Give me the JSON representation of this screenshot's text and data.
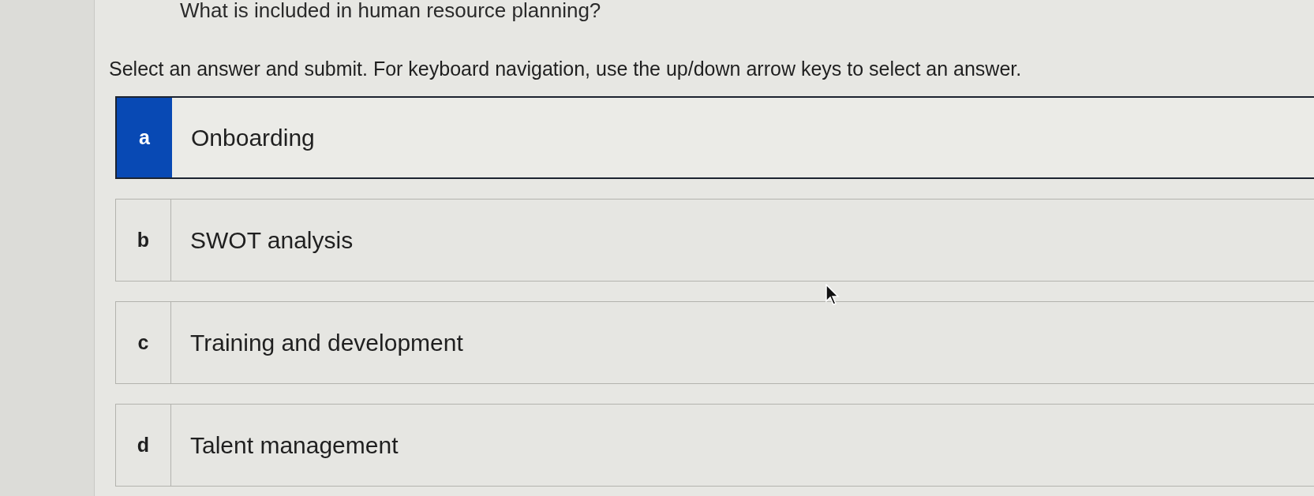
{
  "question": "What is included in human resource planning?",
  "instructions": "Select an answer and submit. For keyboard navigation, use the up/down arrow keys to select an answer.",
  "options": [
    {
      "letter": "a",
      "label": "Onboarding",
      "selected": true
    },
    {
      "letter": "b",
      "label": "SWOT analysis",
      "selected": false
    },
    {
      "letter": "c",
      "label": "Training and development",
      "selected": false
    },
    {
      "letter": "d",
      "label": "Talent management",
      "selected": false
    }
  ]
}
